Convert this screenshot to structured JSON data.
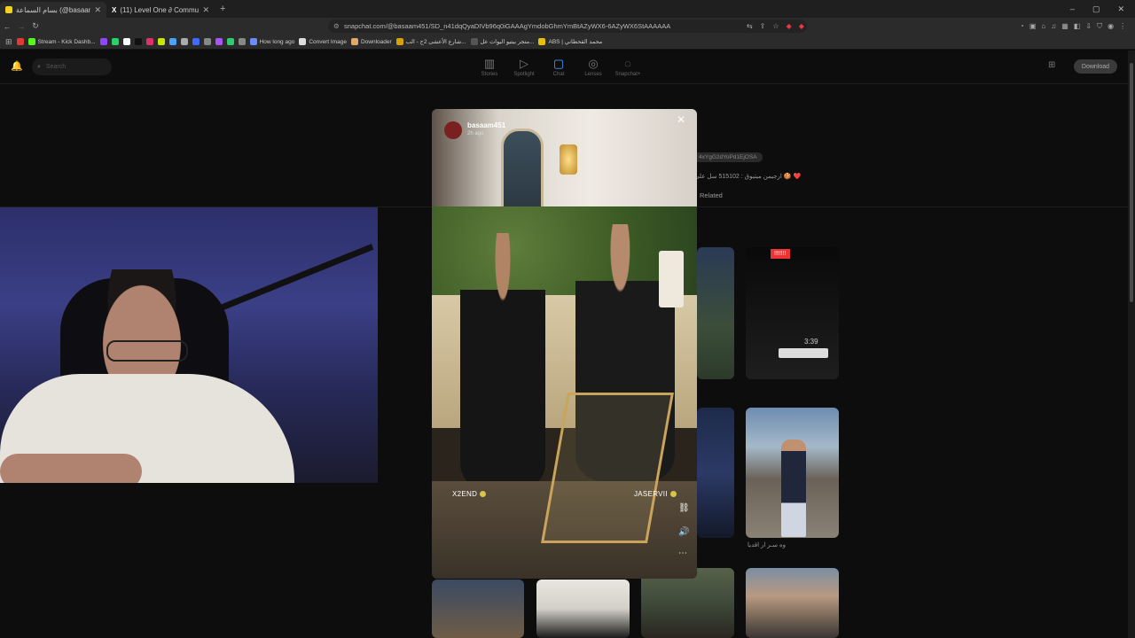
{
  "browser": {
    "tabs": [
      {
        "title": "بسام السماعة (@basaam451)",
        "active": true,
        "color": "#f1d21c"
      },
      {
        "title": "(11) Level One ∂ Community / X",
        "active": false,
        "color": "#ffffff"
      }
    ],
    "new_tab": "+",
    "window_controls": [
      "–",
      "▢",
      "✕"
    ],
    "url": "snapchat.com/@basaam451/SD_n41dqQyaDIVb96q0iGAAAgYmdobGhmYmBtAZyWX6-6AZyWX6StAAAAAA",
    "bookmarks": [
      {
        "label": "",
        "color": "#e53935"
      },
      {
        "label": "Stream - Kick Dashb...",
        "color": "#53fc18"
      },
      {
        "label": "",
        "color": "#9146ff"
      },
      {
        "label": "",
        "color": "#25d366"
      },
      {
        "label": "",
        "color": "#ffffff"
      },
      {
        "label": "",
        "color": "#111111"
      },
      {
        "label": "",
        "color": "#e1306c"
      },
      {
        "label": "",
        "color": "#c8e600"
      },
      {
        "label": "",
        "color": "#4aa3ff"
      },
      {
        "label": "",
        "color": "#aaaaaa"
      },
      {
        "label": "",
        "color": "#3d6bff"
      },
      {
        "label": "",
        "color": "#888888"
      },
      {
        "label": "",
        "color": "#a855f7"
      },
      {
        "label": "",
        "color": "#2ecc71"
      },
      {
        "label": "",
        "color": "#888888"
      },
      {
        "label": "How long ago",
        "color": "#6b8cff"
      },
      {
        "label": "Convert Image",
        "color": "#dddddd"
      },
      {
        "label": "Downloader",
        "color": "#e0a86b"
      },
      {
        "label": "شارع الأعشى 2ج - الب...",
        "color": "#d6a300"
      },
      {
        "label": "متجر بيتيو اليوات عل...",
        "color": "#555555"
      },
      {
        "label": "ABS |  محمد القحطاني",
        "color": "#e5c100"
      }
    ]
  },
  "snapchat": {
    "search_placeholder": "Search",
    "nav": [
      {
        "label": "Stories",
        "icon": "stories-icon",
        "glyph": "▥"
      },
      {
        "label": "Spotlight",
        "icon": "spotlight-icon",
        "glyph": "▷"
      },
      {
        "label": "Chat",
        "icon": "chat-icon",
        "glyph": "▢"
      },
      {
        "label": "Lenses",
        "icon": "lenses-icon",
        "glyph": "◎"
      },
      {
        "label": "Snapchat+",
        "icon": "snapchat-plus-icon",
        "glyph": "◌"
      }
    ],
    "download_label": "Download",
    "profile_code": "4xYgG2dYoPd1EjOSA",
    "profile_bio": "❤️ 🍪 ارجيمن ميتيوق : 515102 سل على الـ",
    "related_label": "Related",
    "thumb_badge": "!!!!!!!",
    "thumb_time": "3:39",
    "thumb_caption": "وه سـر ار اقديا"
  },
  "story": {
    "username": "basaam451",
    "time_ago": "2h ago",
    "close": "✕",
    "tags": [
      "X2END",
      "JASERVII"
    ],
    "actions": [
      {
        "icon": "link-icon",
        "glyph": "🔗"
      },
      {
        "icon": "sound-icon",
        "glyph": "🔊"
      },
      {
        "icon": "more-icon",
        "glyph": "⋯"
      }
    ]
  }
}
